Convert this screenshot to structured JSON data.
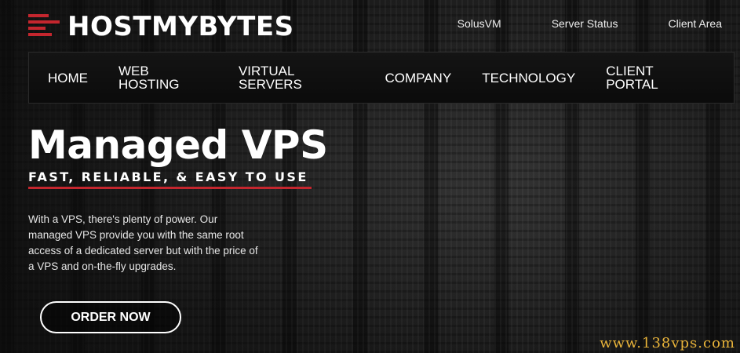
{
  "brand": {
    "name": "HOSTMYBYTES",
    "accent_color": "#c4262e"
  },
  "top_links": [
    "SolusVM",
    "Server Status",
    "Client Area"
  ],
  "nav": {
    "items": [
      "HOME",
      "WEB HOSTING",
      "VIRTUAL SERVERS",
      "COMPANY",
      "TECHNOLOGY",
      "CLIENT PORTAL"
    ]
  },
  "hero": {
    "title": "Managed VPS",
    "subtitle": "FAST, RELIABLE, & EASY TO USE",
    "description": "With a VPS, there's plenty of power. Our managed VPS provide you with the same root access of a dedicated server but with the price of a VPS and on-the-fly upgrades.",
    "cta_label": "ORDER NOW"
  },
  "watermark": "www.138vps.com"
}
